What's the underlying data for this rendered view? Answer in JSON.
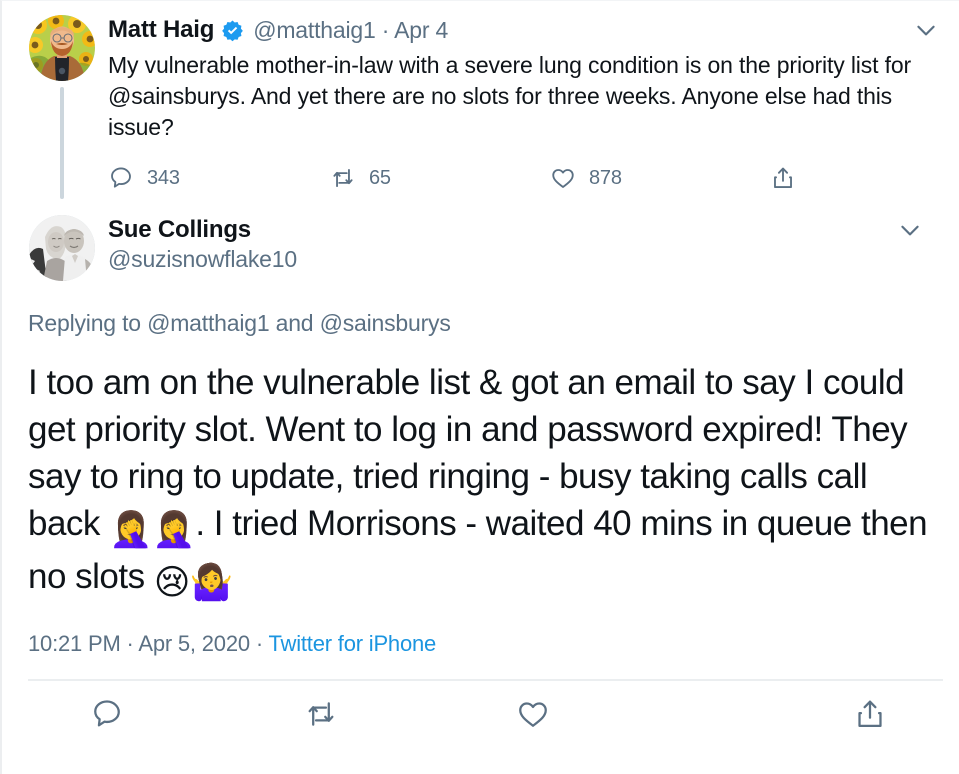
{
  "theme": {
    "text_primary": "#0f1419",
    "text_secondary": "#5b7083",
    "link_blue": "#1b95e0",
    "verified_blue": "#1d9bf0",
    "divider": "#ebeef0",
    "thread_line": "#ccd6dd",
    "background": "#ffffff"
  },
  "parent_tweet": {
    "author": {
      "display_name": "Matt Haig",
      "handle": "@matthaig1",
      "verified": true,
      "avatar_alt": "bearded man in front of sunflowers"
    },
    "separator": "·",
    "timestamp": "Apr 4",
    "caret_icon": "chevron-down-icon",
    "text_parts": [
      {
        "type": "text",
        "value": "My vulnerable mother-in-law with a severe lung condition is on the priority list for "
      },
      {
        "type": "mention",
        "value": "@sainsburys"
      },
      {
        "type": "text",
        "value": ". And yet there are no slots for three weeks. Anyone else had this issue?"
      }
    ],
    "actions": [
      {
        "icon": "reply-icon",
        "name": "reply",
        "count": "343"
      },
      {
        "icon": "retweet-icon",
        "name": "retweet",
        "count": "65"
      },
      {
        "icon": "like-icon",
        "name": "like",
        "count": "878"
      },
      {
        "icon": "share-icon",
        "name": "share",
        "count": ""
      }
    ]
  },
  "focus_tweet": {
    "author": {
      "display_name": "Sue Collings",
      "handle": "@suzisnowflake10",
      "verified": false,
      "avatar_alt": "black and white photo of a woman and a man"
    },
    "caret_icon": "chevron-down-icon",
    "replying_to": {
      "prefix": "Replying to ",
      "mentions": [
        "@matthaig1",
        "@sainsburys"
      ],
      "joiner": " and "
    },
    "body_parts": [
      {
        "type": "text",
        "value": "I too am on the vulnerable list & got an email to say I could get priority slot.  Went to log in and password expired!  They say to ring to update, tried ringing - busy taking calls call back "
      },
      {
        "type": "emoji",
        "value": "🤦‍♀️",
        "name": "woman-facepalming-emoji"
      },
      {
        "type": "emoji",
        "value": "🤦‍♀️",
        "name": "woman-facepalming-emoji"
      },
      {
        "type": "text",
        "value": ". I tried Morrisons - waited 40 mins in queue then no slots "
      },
      {
        "type": "emoji",
        "value": "😢",
        "name": "crying-face-emoji"
      },
      {
        "type": "emoji",
        "value": "🤷‍♀️",
        "name": "woman-shrugging-emoji"
      }
    ],
    "meta": {
      "time": "10:21 PM",
      "dot1": "·",
      "date": "Apr 5, 2020",
      "dot2": "·",
      "source": "Twitter for iPhone"
    },
    "actions": [
      {
        "icon": "reply-icon",
        "name": "reply"
      },
      {
        "icon": "retweet-icon",
        "name": "retweet"
      },
      {
        "icon": "like-icon",
        "name": "like"
      },
      {
        "icon": "share-icon",
        "name": "share"
      }
    ]
  }
}
